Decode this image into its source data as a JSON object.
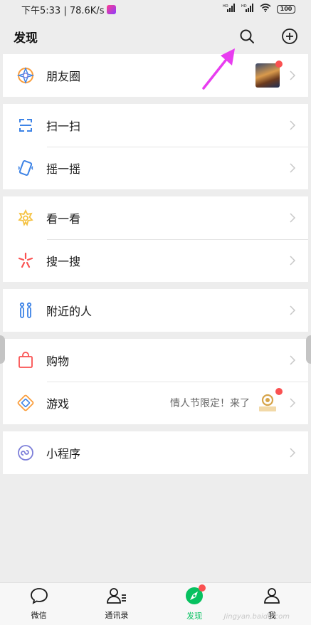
{
  "status_bar": {
    "time_speed": "下午5:33 | 78.6K/s",
    "battery": "100",
    "signal_1": "HD",
    "signal_2": "HD"
  },
  "header": {
    "title": "发现",
    "search_icon": "search-icon",
    "add_icon": "plus-circle-icon"
  },
  "groups": [
    {
      "items": [
        {
          "label": "朋友圈",
          "icon": "moments-icon",
          "color": "#fa9d3b"
        }
      ]
    },
    {
      "items": [
        {
          "label": "扫一扫",
          "icon": "scan-icon",
          "color": "#3d83e6"
        },
        {
          "label": "摇一摇",
          "icon": "shake-icon",
          "color": "#3d83e6"
        }
      ]
    },
    {
      "items": [
        {
          "label": "看一看",
          "icon": "top-stories-icon",
          "color": "#f5c242"
        },
        {
          "label": "搜一搜",
          "icon": "search-discover-icon",
          "color": "#fa5151"
        }
      ]
    },
    {
      "items": [
        {
          "label": "附近的人",
          "icon": "people-nearby-icon",
          "color": "#3d83e6"
        }
      ]
    },
    {
      "items": [
        {
          "label": "购物",
          "icon": "shopping-bag-icon",
          "color": "#fa5151"
        },
        {
          "label": "游戏",
          "icon": "games-icon",
          "color": "#fa9d3b",
          "aux": "情人节限定！来了"
        }
      ]
    },
    {
      "items": [
        {
          "label": "小程序",
          "icon": "mini-programs-icon",
          "color": "#7d7fd9"
        }
      ]
    }
  ],
  "tab_bar": {
    "tabs": [
      {
        "label": "微信",
        "icon": "chat-icon"
      },
      {
        "label": "通讯录",
        "icon": "contacts-icon"
      },
      {
        "label": "发现",
        "icon": "discover-compass-icon",
        "active": true
      },
      {
        "label": "我",
        "icon": "me-icon"
      }
    ]
  },
  "watermark": "Jingyan.baidu.com",
  "colors": {
    "accent": "#07c160",
    "badge": "#fa5151",
    "arrow": "#e83df0"
  }
}
